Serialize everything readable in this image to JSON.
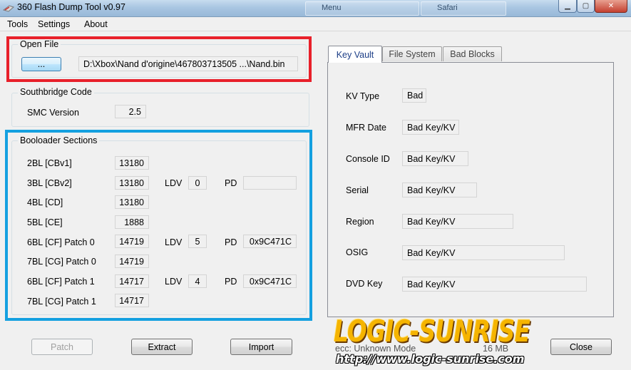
{
  "window": {
    "title": "360 Flash Dump Tool  v0.97",
    "background_windows": [
      "Menu",
      "Safari"
    ]
  },
  "menu": [
    "Tools",
    "Settings",
    "About"
  ],
  "open_file": {
    "label": "Open File",
    "browse_label": "...",
    "path": "D:\\Xbox\\Nand d'origine\\467803713505 ...\\Nand.bin"
  },
  "southbridge": {
    "label": "Southbridge Code",
    "smc_label": "SMC Version",
    "smc_value": "2.5"
  },
  "bootloader": {
    "label": "Booloader Sections",
    "ldv_label": "LDV",
    "pd_label": "PD",
    "rows": [
      {
        "name": "2BL [CBv1]",
        "value": "13180"
      },
      {
        "name": "3BL [CBv2]",
        "value": "13180",
        "ldv": "0",
        "pd": ""
      },
      {
        "name": "4BL [CD]",
        "value": "13180"
      },
      {
        "name": "5BL [CE]",
        "value": "1888"
      },
      {
        "name": "6BL [CF] Patch 0",
        "value": "14719",
        "ldv": "5",
        "pd": "0x9C471C"
      },
      {
        "name": "7BL [CG] Patch 0",
        "value": "14719"
      },
      {
        "name": "6BL [CF] Patch 1",
        "value": "14717",
        "ldv": "4",
        "pd": "0x9C471C"
      },
      {
        "name": "7BL [CG] Patch 1",
        "value": "14717"
      }
    ]
  },
  "tabs": [
    "Key Vault",
    "File System",
    "Bad Blocks"
  ],
  "keyvault": [
    {
      "label": "KV Type",
      "value": "Bad"
    },
    {
      "label": "MFR Date",
      "value": "Bad Key/KV"
    },
    {
      "label": "Console ID",
      "value": "Bad Key/KV"
    },
    {
      "label": "Serial",
      "value": "Bad Key/KV"
    },
    {
      "label": "Region",
      "value": "Bad Key/KV"
    },
    {
      "label": "OSIG",
      "value": "Bad Key/KV"
    },
    {
      "label": "DVD Key",
      "value": "Bad Key/KV"
    }
  ],
  "status": {
    "mode": "ecc: Unknown Mode",
    "size": "16 MB"
  },
  "buttons": {
    "patch": "Patch",
    "extract": "Extract",
    "import": "Import",
    "close": "Close"
  },
  "watermark": {
    "logo": "LOGIC-SUNRISE",
    "url": "http://www.logic-sunrise.com"
  },
  "colors": {
    "highlight_red": "#e8202a",
    "highlight_blue": "#14a0e0",
    "watermark": "#f5b400"
  }
}
